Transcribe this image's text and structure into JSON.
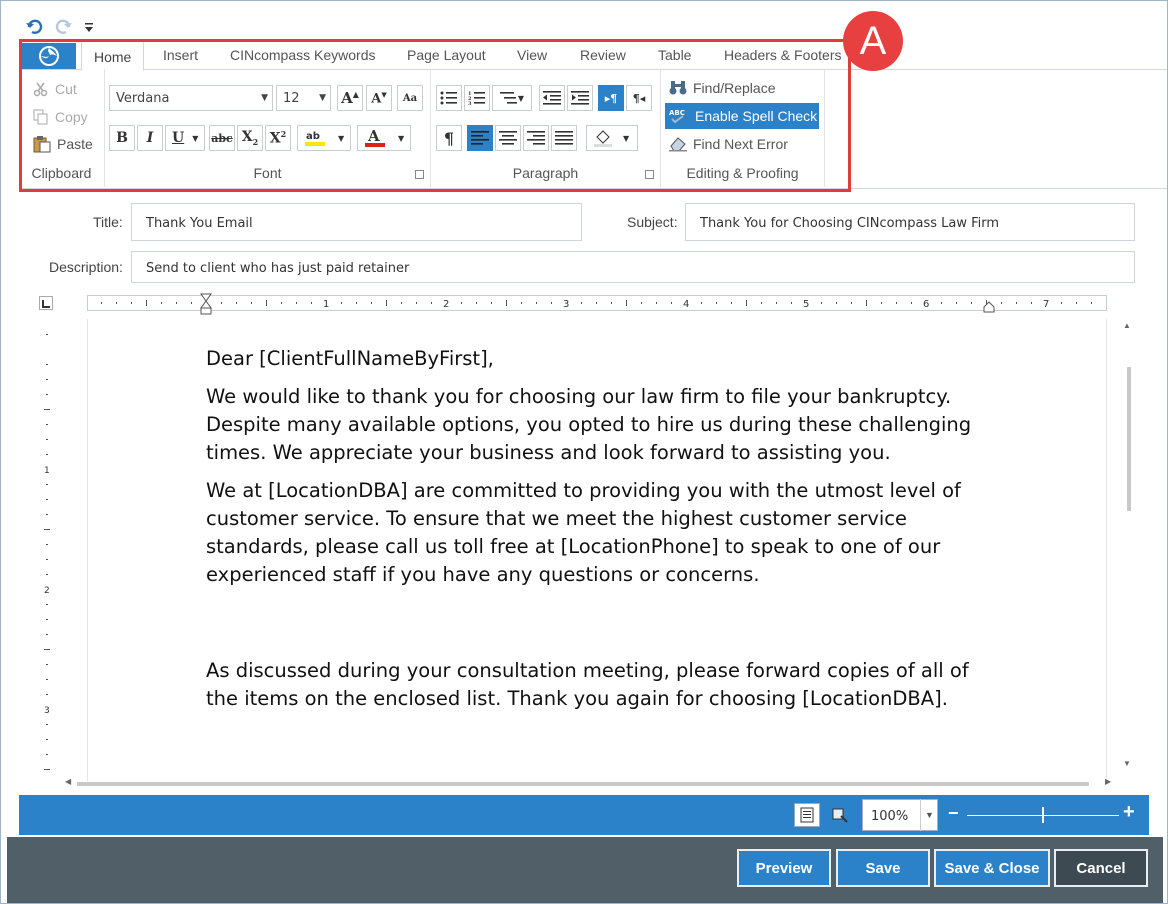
{
  "quick_access": {
    "undo_icon": "undo-icon",
    "redo_icon": "redo-icon",
    "customize_icon": "customize-dropdown-icon"
  },
  "tabs": [
    "Home",
    "Insert",
    "CINcompass Keywords",
    "Page Layout",
    "View",
    "Review",
    "Table",
    "Headers & Footers"
  ],
  "ribbon": {
    "clipboard": {
      "cut": "Cut",
      "copy": "Copy",
      "paste": "Paste",
      "label": "Clipboard"
    },
    "font": {
      "family": "Verdana",
      "size": "12",
      "label": "Font"
    },
    "paragraph": {
      "label": "Paragraph"
    },
    "editing": {
      "find_replace": "Find/Replace",
      "spell_check": "Enable Spell Check",
      "find_next_error": "Find Next Error",
      "label": "Editing & Proofing"
    }
  },
  "callout_badge": "A",
  "form": {
    "title_label": "Title:",
    "title_value": "Thank You Email",
    "subject_label": "Subject:",
    "subject_value": "Thank You for Choosing CINcompass Law Firm",
    "description_label": "Description:",
    "description_value": "Send to client who has just paid retainer"
  },
  "ruler_numbers": [
    "1",
    "2",
    "3",
    "4",
    "5",
    "6",
    "7"
  ],
  "vruler_numbers": [
    "1",
    "2",
    "3"
  ],
  "document": {
    "paragraphs": [
      "Dear [ClientFullNameByFirst],",
      "We would like to thank you for choosing our law firm to file your bankruptcy. Despite many available options, you opted to hire us during these challenging times. We appreciate your business and look forward to assisting you.",
      "We at [LocationDBA] are committed to providing you with the utmost level of customer service. To ensure that we meet the highest customer service standards, please call us toll free at [LocationPhone] to speak to one of our experienced staff if you have any questions or concerns.",
      "As discussed during your consultation meeting, please forward copies of all of the items on the enclosed list. Thank you again for choosing [LocationDBA]."
    ]
  },
  "status": {
    "zoom": "100%",
    "zoom_level": 1.0,
    "zoom_minus": "−",
    "zoom_plus": "+"
  },
  "footer": {
    "preview": "Preview",
    "save": "Save",
    "save_close": "Save & Close",
    "cancel": "Cancel"
  },
  "colors": {
    "accent": "#2b82c9",
    "callout": "#e03c3c",
    "footer_bg": "#505f68"
  }
}
